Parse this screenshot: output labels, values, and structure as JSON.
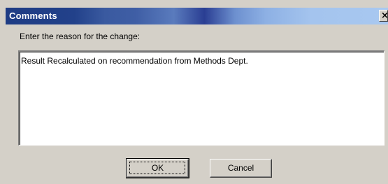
{
  "window": {
    "title": "Comments",
    "close_glyph": "×"
  },
  "prompt": {
    "label": "Enter the reason for the change:"
  },
  "comment": {
    "value": "Result Recalculated on recommendation from Methods Dept."
  },
  "buttons": {
    "ok_label": "OK",
    "cancel_label": "Cancel"
  }
}
